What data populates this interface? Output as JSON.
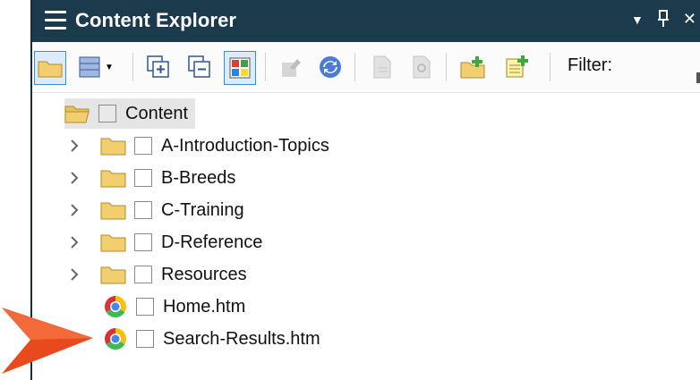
{
  "panel": {
    "title": "Content Explorer",
    "controls": {
      "dropdown": "▼",
      "pin": "🖈",
      "close": "✕"
    }
  },
  "toolbar": {
    "filter_label": "Filter:",
    "buttons": [
      {
        "name": "open-folder-button",
        "icon": "folder-icon",
        "selected": true
      },
      {
        "name": "view-dropdown-button",
        "icon": "grid-view-icon"
      },
      {
        "name": "expand-all-button",
        "icon": "expand-all-icon"
      },
      {
        "name": "collapse-all-button",
        "icon": "collapse-all-icon"
      },
      {
        "name": "color-tiles-button",
        "icon": "color-tiles-icon",
        "selected": true
      },
      {
        "name": "move-up-button",
        "icon": "move-up-icon",
        "disabled": true
      },
      {
        "name": "refresh-button",
        "icon": "refresh-icon"
      },
      {
        "name": "new-topic-button",
        "icon": "new-topic-icon",
        "disabled": true
      },
      {
        "name": "find-button",
        "icon": "find-icon",
        "disabled": true
      },
      {
        "name": "new-folder-button",
        "icon": "new-folder-icon"
      },
      {
        "name": "add-file-button",
        "icon": "add-file-icon"
      }
    ]
  },
  "tree": {
    "root_label": "Content",
    "items": [
      {
        "label": "A-Introduction-Topics",
        "type": "folder"
      },
      {
        "label": "B-Breeds",
        "type": "folder"
      },
      {
        "label": "C-Training",
        "type": "folder"
      },
      {
        "label": "D-Reference",
        "type": "folder"
      },
      {
        "label": "Resources",
        "type": "folder"
      },
      {
        "label": "Home.htm",
        "type": "file",
        "icon": "chrome-icon"
      },
      {
        "label": "Search-Results.htm",
        "type": "file",
        "icon": "chrome-icon"
      }
    ]
  },
  "callout": {
    "icon": "pointer-arrow-icon",
    "color": "#e8491d"
  },
  "colors": {
    "titlebar": "#1b3a4b",
    "selection": "#3c8fd6",
    "folder": "#f2cf6e"
  }
}
